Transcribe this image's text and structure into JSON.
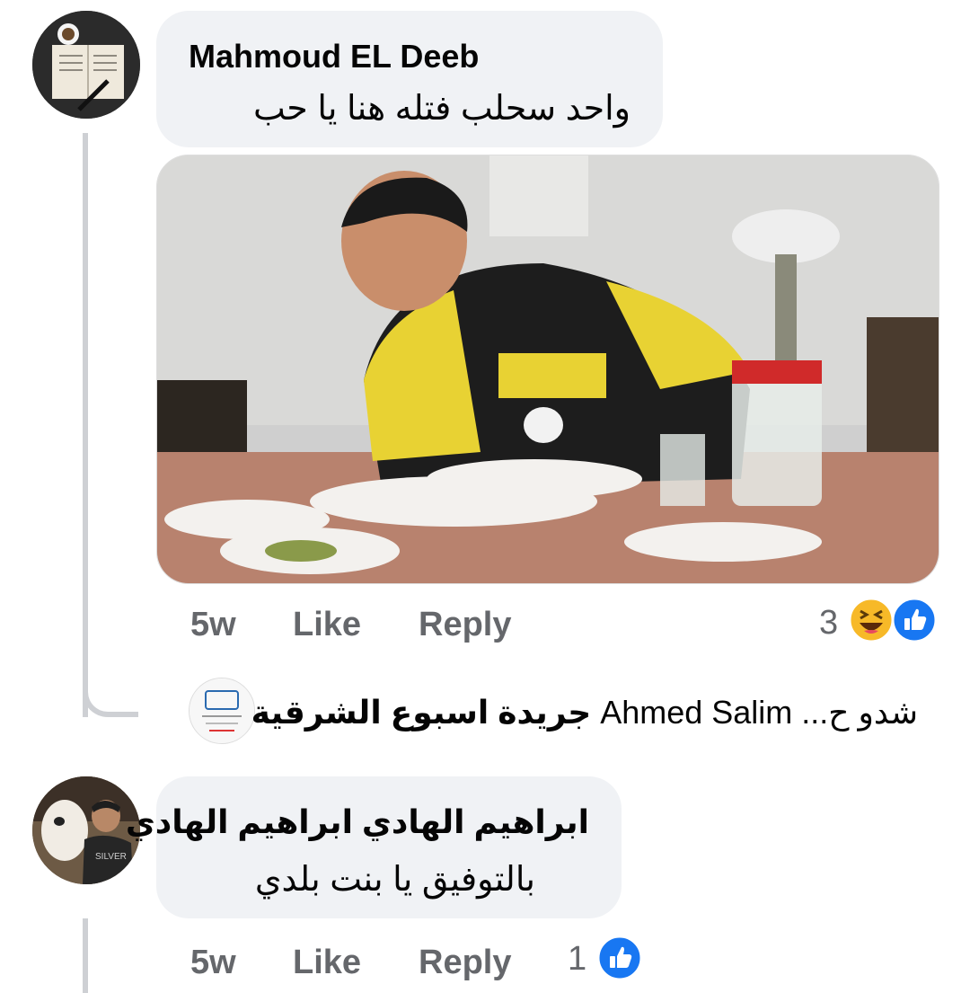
{
  "comments": [
    {
      "author": "Mahmoud EL Deeb",
      "text": "واحد سحلب فتله هنا يا حب",
      "time": "5w",
      "like": "Like",
      "reply": "Reply",
      "reaction_count": "3",
      "reactions": [
        "haha-icon",
        "like-icon"
      ]
    },
    {
      "author": "ابراهيم الهادي ابراهيم الهادي",
      "text": "بالتوفيق يا بنت  بلدي",
      "time": "5w",
      "like": "Like",
      "reply": "Reply",
      "reaction_count": "1",
      "reactions": [
        "like-icon"
      ]
    }
  ],
  "reply_preview": {
    "author": "جريدة اسبوع الشرقية",
    "mention": "Ahmed Salim",
    "snippet": "شدو ح..."
  },
  "colors": {
    "bubble": "#f0f2f5",
    "meta_text": "#65676b",
    "like_blue": "#1877f2",
    "haha_yellow": "#f7b928"
  }
}
